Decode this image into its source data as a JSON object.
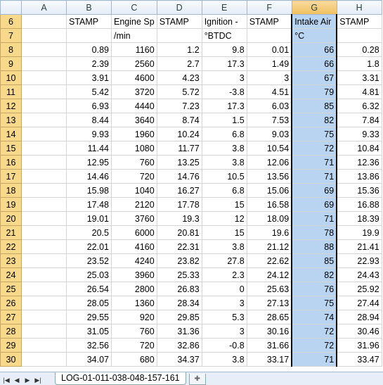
{
  "columns": [
    "A",
    "B",
    "C",
    "D",
    "E",
    "F",
    "G",
    "H"
  ],
  "header_rows": [
    {
      "row": "6",
      "cells": [
        "",
        "STAMP",
        "Engine Sp",
        "STAMP",
        "Ignition - ",
        "STAMP",
        "Intake Air",
        "STAMP"
      ]
    },
    {
      "row": "7",
      "cells": [
        "",
        "",
        "/min",
        "",
        "°BTDC",
        "",
        "°C",
        ""
      ]
    }
  ],
  "rows": [
    [
      "8",
      "",
      "0.89",
      "1160",
      "1.2",
      "9.8",
      "0.01",
      "66",
      "0.28"
    ],
    [
      "9",
      "",
      "2.39",
      "2560",
      "2.7",
      "17.3",
      "1.49",
      "66",
      "1.8"
    ],
    [
      "10",
      "",
      "3.91",
      "4600",
      "4.23",
      "3",
      "3",
      "67",
      "3.31"
    ],
    [
      "11",
      "",
      "5.42",
      "3720",
      "5.72",
      "-3.8",
      "4.51",
      "79",
      "4.81"
    ],
    [
      "12",
      "",
      "6.93",
      "4440",
      "7.23",
      "17.3",
      "6.03",
      "85",
      "6.32"
    ],
    [
      "13",
      "",
      "8.44",
      "3640",
      "8.74",
      "1.5",
      "7.53",
      "82",
      "7.84"
    ],
    [
      "14",
      "",
      "9.93",
      "1960",
      "10.24",
      "6.8",
      "9.03",
      "75",
      "9.33"
    ],
    [
      "15",
      "",
      "11.44",
      "1080",
      "11.77",
      "3.8",
      "10.54",
      "72",
      "10.84"
    ],
    [
      "16",
      "",
      "12.95",
      "760",
      "13.25",
      "3.8",
      "12.06",
      "71",
      "12.36"
    ],
    [
      "17",
      "",
      "14.46",
      "720",
      "14.76",
      "10.5",
      "13.56",
      "71",
      "13.86"
    ],
    [
      "18",
      "",
      "15.98",
      "1040",
      "16.27",
      "6.8",
      "15.06",
      "69",
      "15.36"
    ],
    [
      "19",
      "",
      "17.48",
      "2120",
      "17.78",
      "15",
      "16.58",
      "69",
      "16.88"
    ],
    [
      "20",
      "",
      "19.01",
      "3760",
      "19.3",
      "12",
      "18.09",
      "71",
      "18.39"
    ],
    [
      "21",
      "",
      "20.5",
      "6000",
      "20.81",
      "15",
      "19.6",
      "78",
      "19.9"
    ],
    [
      "22",
      "",
      "22.01",
      "4160",
      "22.31",
      "3.8",
      "21.12",
      "88",
      "21.41"
    ],
    [
      "23",
      "",
      "23.52",
      "4240",
      "23.82",
      "27.8",
      "22.62",
      "85",
      "22.93"
    ],
    [
      "24",
      "",
      "25.03",
      "3960",
      "25.33",
      "2.3",
      "24.12",
      "82",
      "24.43"
    ],
    [
      "25",
      "",
      "26.54",
      "2800",
      "26.83",
      "0",
      "25.63",
      "76",
      "25.92"
    ],
    [
      "26",
      "",
      "28.05",
      "1360",
      "28.34",
      "3",
      "27.13",
      "75",
      "27.44"
    ],
    [
      "27",
      "",
      "29.55",
      "920",
      "29.85",
      "5.3",
      "28.65",
      "74",
      "28.94"
    ],
    [
      "28",
      "",
      "31.05",
      "760",
      "31.36",
      "3",
      "30.16",
      "72",
      "30.46"
    ],
    [
      "29",
      "",
      "32.56",
      "720",
      "32.86",
      "-0.8",
      "31.66",
      "72",
      "31.96"
    ],
    [
      "30",
      "",
      "34.07",
      "680",
      "34.37",
      "3.8",
      "33.17",
      "71",
      "33.47"
    ]
  ],
  "sheet_tab": "LOG-01-011-038-048-157-161",
  "selected_column": "G",
  "colors": {
    "selection": "#b8d4f0",
    "row_header": "#f8d88a",
    "col_header_selected": "#f1c15f"
  }
}
